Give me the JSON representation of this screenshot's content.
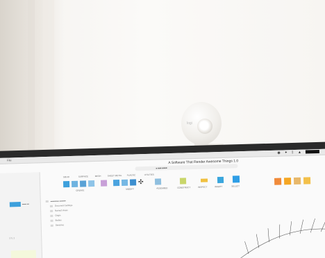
{
  "screen": {
    "app_title": "A Software That Render Awesome Things 1.0",
    "menu_file": "File",
    "toolbar_groups": [
      "CREATE",
      "MODIFY",
      "ASSEMBLE",
      "CONSTRUCT",
      "INSPECT",
      "INSERT",
      "SELECT"
    ],
    "tabs": [
      "SOLID",
      "SURFACE",
      "MESH",
      "SHEET METAL",
      "PLASTIC",
      "UTILITIES"
    ],
    "sidebar_label": "STL 3",
    "browser_rows": [
      "Document Settings",
      "Named Views",
      "Origin",
      "Bodies",
      "Sketches"
    ]
  },
  "webcam": {
    "logo": "logi"
  },
  "colors": {
    "accent": "#3da0dc",
    "screen_bg": "#fafafa",
    "bezel": "#2a2a2a"
  }
}
